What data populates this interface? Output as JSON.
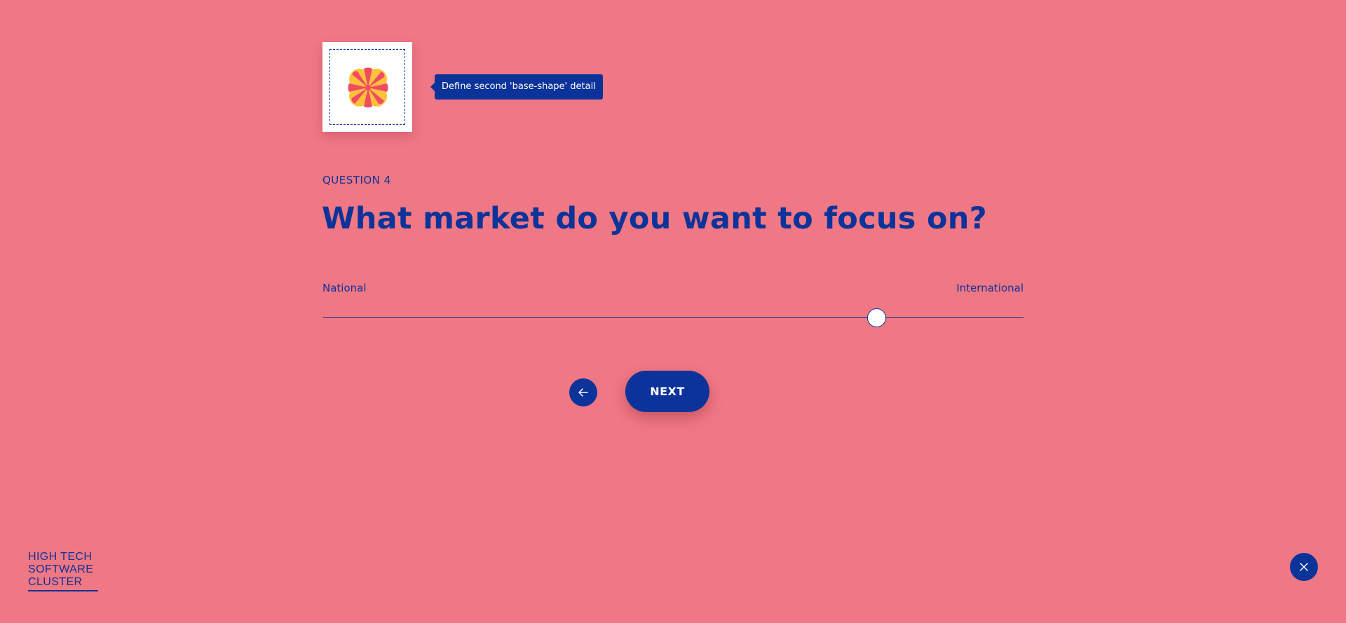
{
  "preview": {
    "shape_icon": "flower-base-shape",
    "shape_colors": {
      "petal": "#f24a61",
      "fill": "#fdc23d"
    }
  },
  "tooltip": {
    "text": "Define second 'base-shape' detail"
  },
  "question": {
    "number_label": "QUESTION 4",
    "title": "What market do you want to focus on?"
  },
  "slider": {
    "min_label": "National",
    "max_label": "International",
    "value_percent": 79
  },
  "navigation": {
    "back_icon": "arrow-left-icon",
    "next_label": "NEXT"
  },
  "logo": {
    "lines": [
      "HIGH TECH",
      "SOFTWARE",
      "CLUSTER"
    ]
  },
  "close": {
    "icon": "close-icon"
  },
  "colors": {
    "background": "#f07784",
    "primary": "#0c3399",
    "white": "#ffffff"
  }
}
